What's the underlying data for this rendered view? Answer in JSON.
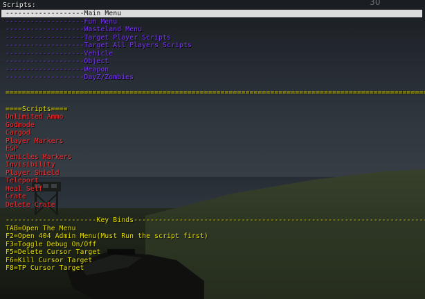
{
  "window": {
    "header": "Scripts:",
    "fps": "30"
  },
  "menu": {
    "items": [
      {
        "label": "-------------------Main Menu",
        "selected": true
      },
      {
        "label": "-------------------Fun Menu"
      },
      {
        "label": "-------------------Wasteland Menu"
      },
      {
        "label": "-------------------Target Player Scripts"
      },
      {
        "label": "-------------------Target All Players Scripts"
      },
      {
        "label": "-------------------Vehicle"
      },
      {
        "label": "-------------------Object"
      },
      {
        "label": "-------------------Weapon"
      },
      {
        "label": "-------------------DayZ/Zombies"
      }
    ]
  },
  "separator": "============================================================================================================================",
  "scripts": {
    "header": "====Scripts====",
    "items": [
      "Unlimited Ammo",
      "Godmode",
      "Cargod",
      "Player Markers",
      "ESP",
      "Vehicles Markers",
      "Invisibility",
      "Player Shield",
      "Teleport",
      "Heal Self",
      "Crate",
      "Delete Crate"
    ]
  },
  "keybinds": {
    "header": "----------------------Key Binds---------------------------------------------------------------------------",
    "items": [
      "TAB=Open The Menu",
      "F2=Open 404 Admin Menu(Must Run the script first)",
      "F3=Toggle Debug On/Off",
      "F5=Delete Cursor Target",
      "F6=Kill Cursor Target",
      "F8=TP Cursor Target"
    ]
  },
  "colors": {
    "menu_item": "#7b33ff",
    "selected_bar": "#dcdcdc",
    "separator": "#e8e000",
    "script_item": "#ff2a2a",
    "keybind": "#e8e000"
  }
}
